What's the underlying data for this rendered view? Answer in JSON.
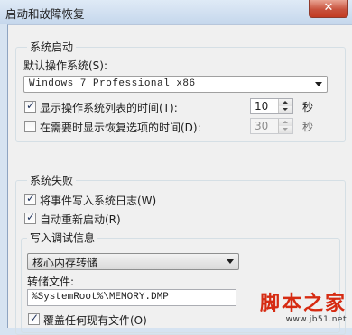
{
  "window": {
    "title": "启动和故障恢复",
    "close_glyph": "✕"
  },
  "system_startup": {
    "group_label": "系统启动",
    "default_os_label": "默认操作系统(S):",
    "default_os_value": "Windows 7 Professional x86",
    "show_os_list": {
      "label": "显示操作系统列表的时间(T):",
      "checked": true,
      "value": "10",
      "unit": "秒"
    },
    "show_recovery": {
      "label": "在需要时显示恢复选项的时间(D):",
      "checked": false,
      "value": "30",
      "unit": "秒"
    }
  },
  "system_failure": {
    "group_label": "系统失败",
    "write_event_log": {
      "label": "将事件写入系统日志(W)",
      "checked": true
    },
    "auto_restart": {
      "label": "自动重新启动(R)",
      "checked": true
    },
    "debug_info": {
      "group_label": "写入调试信息",
      "dump_type_value": "核心内存转储",
      "dump_file_label": "转储文件:",
      "dump_file_value": "%SystemRoot%\\MEMORY.DMP",
      "overwrite": {
        "label": "覆盖任何现有文件(O)",
        "checked": true
      }
    }
  },
  "watermark": {
    "logo_text": "脚本之家",
    "url_text": "www.jb51.net"
  },
  "colors": {
    "accent_close": "#c8523d",
    "watermark": "#d62b12"
  }
}
